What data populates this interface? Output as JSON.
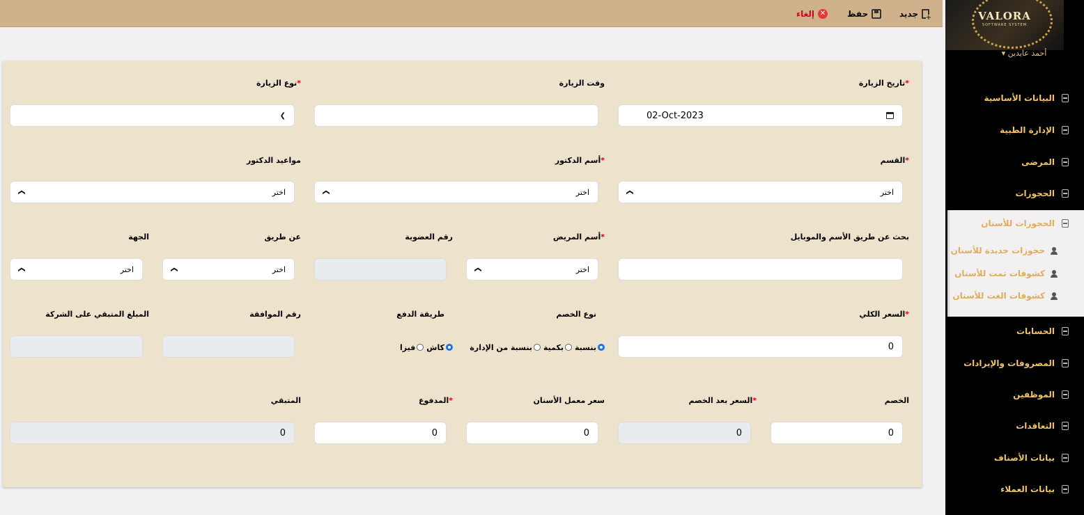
{
  "toolbar": {
    "new_label": "جديد",
    "save_label": "حفظ",
    "cancel_label": "إلغاء"
  },
  "sidebar": {
    "logo_text": "VALORA",
    "logo_tagline": "SOFTWARE SYSTEM",
    "user_name": "أحمد عايدين ▾",
    "items": [
      "البيانات الأساسية",
      "الإدارة الطبية",
      "المرضى",
      "الحجوزات",
      "الحسابات",
      "المصروفات والإيرادات",
      "الموظفين",
      "التعاقدات",
      "بيانات الأصناف",
      "بيانات العملاء"
    ],
    "sub_menu": {
      "title": "الحجوزات للأسنان",
      "items": [
        "حجوزات جديدة للأسنان",
        "كشوفات تمت للأسنان",
        "كشوفات الغت للأسنان"
      ]
    }
  },
  "form": {
    "visit_date_label": "تاريخ الزيارة",
    "visit_date_value": "02-Oct-2023",
    "visit_time_label": "وقت الزيارة",
    "visit_type_label": "نوع الزيارة",
    "department_label": "القسم",
    "doctor_name_label": "أسم الدكتور",
    "doctor_schedule_label": "مواعيد الدكتور",
    "choose": "اختر",
    "search_label": "بحث عن طريق الأسم والموبايل",
    "patient_name_label": "أسم المريض",
    "membership_label": "رقم العضوية",
    "via_label": "عن طريق",
    "entity_label": "الجهة",
    "total_price_label": "السعر الكلي",
    "total_price_value": "0",
    "discount_type_label": "نوع الخصم",
    "discount_types": [
      "بنسبة",
      "بكمية",
      "بنسبة من الإدارة"
    ],
    "payment_method_label": "طريقة الدفع",
    "payment_methods": [
      "كاش",
      "فيزا"
    ],
    "approval_number_label": "رقم الموافقة",
    "company_remaining_label": "المبلغ المتبقي على الشركة",
    "discount_label": "الخصم",
    "discount_value": "0",
    "price_after_discount_label": "السعر بعد الخصم",
    "price_after_discount_value": "0",
    "lab_price_label": "سعر معمل الأسنان",
    "lab_price_value": "0",
    "paid_label": "المدفوع",
    "paid_value": "0",
    "remaining_label": "المتبقي",
    "remaining_value": "0"
  }
}
